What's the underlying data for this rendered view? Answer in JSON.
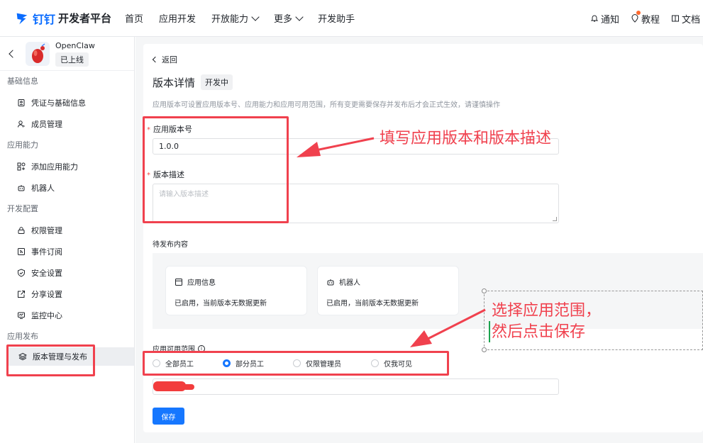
{
  "brand": {
    "logo_text": "钉钉",
    "platform_text": "开发者平台"
  },
  "nav": {
    "items": [
      {
        "label": "首页",
        "dropdown": false
      },
      {
        "label": "应用开发",
        "dropdown": false
      },
      {
        "label": "开放能力",
        "dropdown": true
      },
      {
        "label": "更多",
        "dropdown": true
      },
      {
        "label": "开发助手",
        "dropdown": false
      }
    ],
    "right": {
      "notify": "通知",
      "tutorial": "教程",
      "docs": "文档"
    }
  },
  "app": {
    "name": "OpenClaw",
    "status": "已上线"
  },
  "sidebar": {
    "groups": [
      {
        "title": "基础信息",
        "items": [
          {
            "label": "凭证与基础信息",
            "icon": "credential-icon"
          },
          {
            "label": "成员管理",
            "icon": "member-icon"
          }
        ]
      },
      {
        "title": "应用能力",
        "items": [
          {
            "label": "添加应用能力",
            "icon": "add-capability-icon"
          },
          {
            "label": "机器人",
            "icon": "robot-icon"
          }
        ]
      },
      {
        "title": "开发配置",
        "items": [
          {
            "label": "权限管理",
            "icon": "lock-icon"
          },
          {
            "label": "事件订阅",
            "icon": "subscribe-icon"
          },
          {
            "label": "安全设置",
            "icon": "shield-icon"
          },
          {
            "label": "分享设置",
            "icon": "share-icon"
          },
          {
            "label": "监控中心",
            "icon": "monitor-icon"
          }
        ]
      },
      {
        "title": "应用发布",
        "items": [
          {
            "label": "版本管理与发布",
            "icon": "layers-icon",
            "active": true
          }
        ]
      }
    ]
  },
  "main": {
    "back": "返回",
    "title": "版本详情",
    "status_tag": "开发中",
    "description": "应用版本可设置应用版本号、应用能力和应用可用范围，所有变更需要保存并发布后才会正式生效，请谨慎操作",
    "version_label": "应用版本号",
    "version_value": "1.0.0",
    "desc_label": "版本描述",
    "desc_placeholder": "请输入版本描述",
    "pending_label": "待发布内容",
    "pending_cards": [
      {
        "title": "应用信息",
        "text": "已启用，当前版本无数据更新",
        "icon": "app-info-icon"
      },
      {
        "title": "机器人",
        "text": "已启用，当前版本无数据更新",
        "icon": "robot-icon"
      }
    ],
    "scope_label": "应用可用范围",
    "scope_options": [
      {
        "label": "全部员工",
        "selected": false
      },
      {
        "label": "部分员工",
        "selected": true
      },
      {
        "label": "仅限管理员",
        "selected": false
      },
      {
        "label": "仅我可见",
        "selected": false
      }
    ],
    "save_label": "保存"
  },
  "annotations": {
    "version_hint": "填写应用版本和版本描述",
    "scope_hint_line1": "选择应用范围，",
    "scope_hint_line2": "然后点击保存",
    "color": "#f0414e"
  }
}
